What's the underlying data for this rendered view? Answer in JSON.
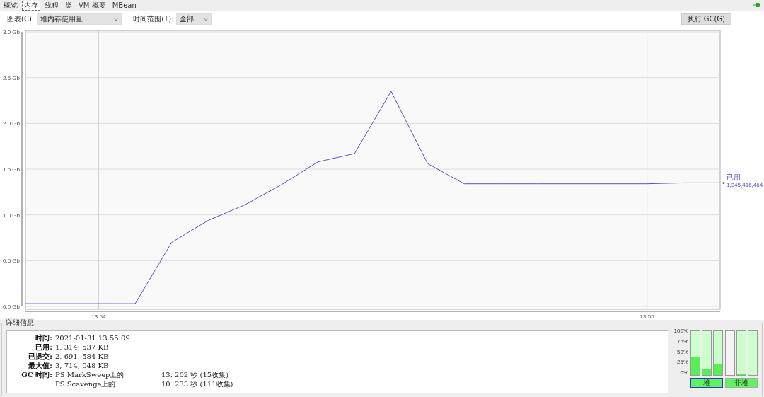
{
  "tabs": [
    {
      "label": "概览",
      "selected": false
    },
    {
      "label": "内存",
      "selected": true
    },
    {
      "label": "线程",
      "selected": false
    },
    {
      "label": "类",
      "selected": false
    },
    {
      "label": "VM 概要",
      "selected": false
    },
    {
      "label": "MBean",
      "selected": false
    }
  ],
  "toolbar": {
    "chart_label": "图表(C):",
    "chart_select": "堆内存使用量",
    "range_label": "时间范围(T):",
    "range_select": "全部",
    "gc_button": "执行 GC(G)"
  },
  "chart": {
    "legend_value": "1,345,416,464",
    "chart_data": {
      "type": "line",
      "grid": true,
      "categories": [
        null,
        null,
        "13:54",
        null,
        null,
        null,
        null,
        null,
        null,
        null,
        null,
        null,
        null,
        null,
        null,
        null,
        null,
        "13:55",
        null,
        null
      ],
      "series": [
        {
          "name": "已用",
          "color": "#5a4fcf",
          "values": [
            0.03,
            0.03,
            0.03,
            0.03,
            0.7,
            0.94,
            1.11,
            1.33,
            1.58,
            1.67,
            2.35,
            1.56,
            1.34,
            1.34,
            1.34,
            1.34,
            1.34,
            1.34,
            1.35,
            1.35
          ]
        }
      ],
      "ylim": [
        0,
        3
      ],
      "yticks": [
        {
          "value": 0,
          "label": "0.0 Gb"
        },
        {
          "value": 0.5,
          "label": "0.5 Gb"
        },
        {
          "value": 1,
          "label": "1.0 Gb"
        },
        {
          "value": 1.5,
          "label": "1.5 Gb"
        },
        {
          "value": 2,
          "label": "2.0 Gb"
        },
        {
          "value": 2.5,
          "label": "2.5 Gb"
        },
        {
          "value": 3,
          "label": "3.0 Gb"
        }
      ]
    }
  },
  "details": {
    "title": "详细信息",
    "fields": [
      {
        "label": "时间:",
        "value": "2021-01-31 13:55:09"
      },
      {
        "label": "已用:",
        "value": "1, 314, 537 KB"
      },
      {
        "label": "已提交:",
        "value": "2, 691, 584 KB"
      },
      {
        "label": "最大值:",
        "value": "3, 714, 048 KB"
      }
    ],
    "gc_label": "GC 时间:",
    "gc": [
      {
        "name": "PS MarkSweep上的",
        "value": "13. 202  秒 (15收集)"
      },
      {
        "name": "PS Scavenge上的",
        "value": "10. 233  秒 (111收集)"
      }
    ]
  },
  "pools": {
    "axis": [
      "100%",
      "75%",
      "50%",
      "25%",
      "0%"
    ],
    "groups": [
      {
        "label": "堆",
        "selected": true,
        "bars": [
          {
            "committed": true,
            "level": 0.4
          },
          {
            "committed": true,
            "level": 0.15
          },
          {
            "committed": true,
            "level": 0.25
          }
        ]
      },
      {
        "label": "非堆",
        "selected": false,
        "bars": [
          {
            "committed": false
          },
          {
            "committed": true,
            "level": 0.02
          },
          {
            "committed": true
          }
        ]
      }
    ]
  }
}
